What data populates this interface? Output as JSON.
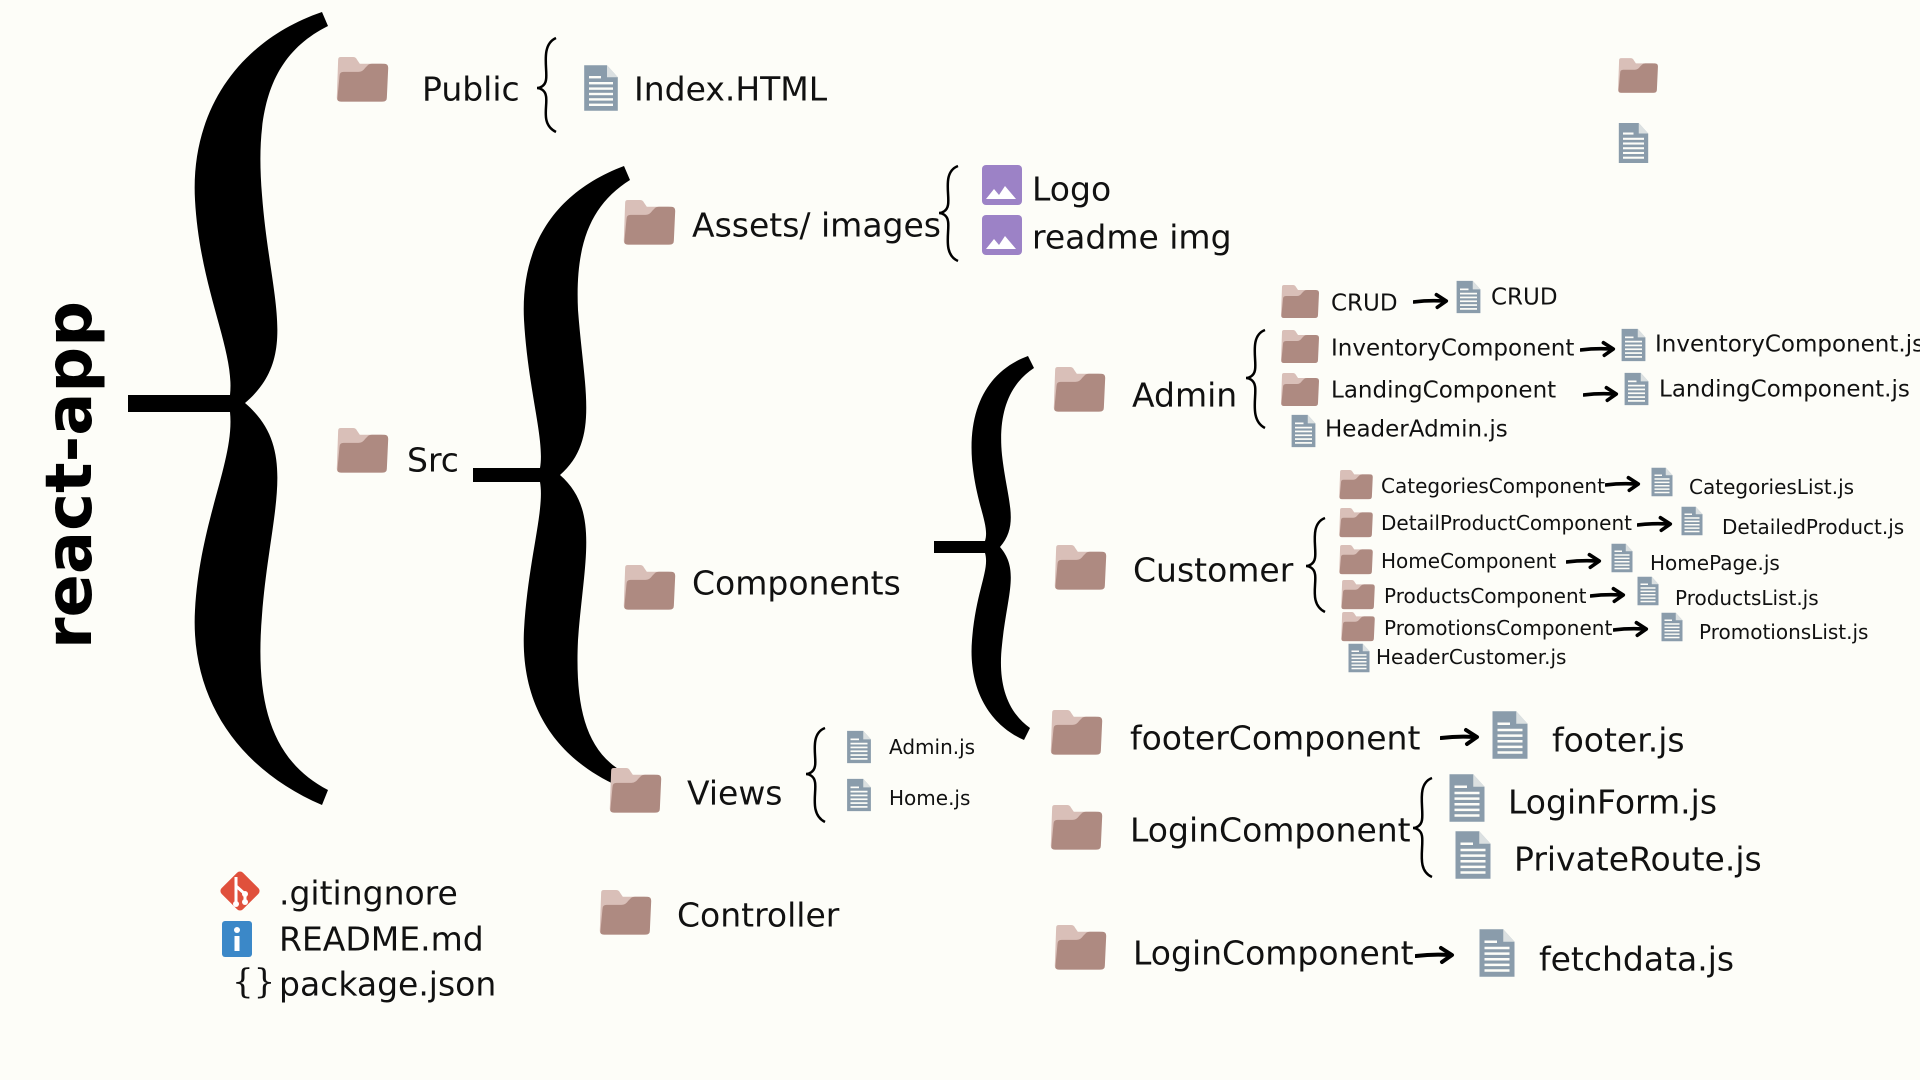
{
  "root": {
    "title": "react-app"
  },
  "colors": {
    "folder_back": "#d9bfb8",
    "folder_front": "#ae8a81",
    "doc": "#8a9cab",
    "image": "#9c82c6",
    "git": "#e0503c",
    "info": "#3b88c8",
    "text": "#111111",
    "background": "#fdfdf8"
  },
  "public": {
    "label": "Public",
    "files": [
      "Index.HTML"
    ]
  },
  "src": {
    "label": "Src",
    "assets": {
      "label": "Assets/ images",
      "files": [
        "Logo",
        "readme img"
      ]
    },
    "components": {
      "label": "Components",
      "admin": {
        "label": "Admin",
        "crud": {
          "folder": "CRUD",
          "file": "CRUD"
        },
        "inventory": {
          "folder": "InventoryComponent",
          "file": "InventoryComponent.js"
        },
        "landing": {
          "folder": "LandingComponent",
          "file": "LandingComponent.js"
        },
        "header": "HeaderAdmin.js"
      },
      "customer": {
        "label": "Customer",
        "items": [
          {
            "folder": "CategoriesComponent",
            "file": "CategoriesList.js"
          },
          {
            "folder": "DetailProductComponent",
            "file": "DetailedProduct.js"
          },
          {
            "folder": "HomeComponent",
            "file": "HomePage.js"
          },
          {
            "folder": "ProductsComponent",
            "file": "ProductsList.js"
          },
          {
            "folder": "PromotionsComponent",
            "file": "PromotionsList.js"
          }
        ],
        "header": "HeaderCustomer.js"
      },
      "footer": {
        "folder": "footerComponent",
        "file": "footer.js"
      },
      "login": {
        "folder": "LoginComponent",
        "files": [
          "LoginForm.js",
          "PrivateRoute.js"
        ]
      },
      "login2": {
        "folder": "LoginComponent",
        "file": "fetchdata.js"
      }
    },
    "views": {
      "label": "Views",
      "files": [
        "Admin.js",
        "Home.js"
      ]
    },
    "controller": {
      "label": "Controller"
    }
  },
  "root_files": [
    ".gitingnore",
    "README.md",
    "package.json"
  ],
  "legend": {
    "folder_icon": "folder-icon",
    "file_icon": "file-icon"
  }
}
